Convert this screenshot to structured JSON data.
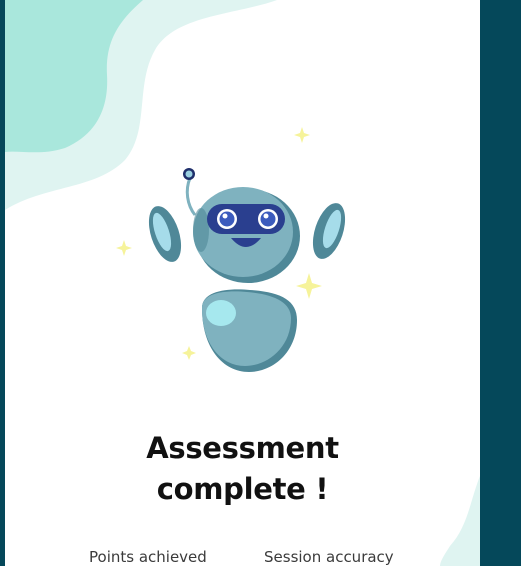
{
  "colors": {
    "outer_background": "#05485a",
    "card_background": "#ffffff",
    "blob_dark": "#a9e7dc",
    "blob_light": "#dff4f1",
    "robot_body": "#7fb2bf",
    "robot_visor": "#2a3f8f",
    "sparkle": "#f6f39a"
  },
  "illustration": {
    "icon": "robot-illustration-icon"
  },
  "result": {
    "title_line1": "Assessment",
    "title_line2": "complete !"
  },
  "stats": {
    "points_label": "Points achieved",
    "accuracy_label": "Session accuracy"
  }
}
